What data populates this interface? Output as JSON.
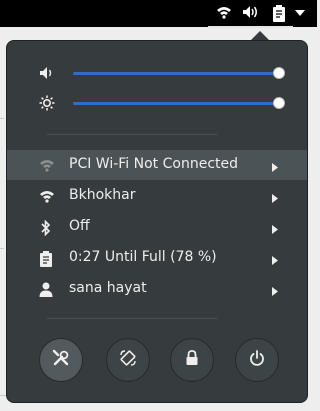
{
  "sliders": [
    {
      "name": "volume",
      "icon": "speaker-icon",
      "level": 1.0
    },
    {
      "name": "brightness",
      "icon": "brightness-icon",
      "level": 1.0
    }
  ],
  "menu": [
    {
      "label": "PCI Wi-Fi Not Connected",
      "icon": "wifi-off-icon",
      "highlight": true
    },
    {
      "label": "Bkhokhar",
      "icon": "wifi-icon"
    },
    {
      "label": "Off",
      "icon": "bluetooth-icon"
    },
    {
      "label": "0:27 Until Full (78 %)",
      "icon": "battery-charging-icon"
    },
    {
      "label": "sana hayat",
      "icon": "user-icon"
    }
  ],
  "actions": [
    {
      "name": "settings",
      "icon": "tools-icon"
    },
    {
      "name": "rotation-lock",
      "icon": "rotation-icon"
    },
    {
      "name": "lock",
      "icon": "lock-icon"
    },
    {
      "name": "power-off",
      "icon": "power-icon"
    }
  ],
  "colors": {
    "popup_bg": "#363c3e",
    "accent": "#2f6ec2",
    "text": "#eeeeec",
    "highlight": "#4c5356"
  }
}
